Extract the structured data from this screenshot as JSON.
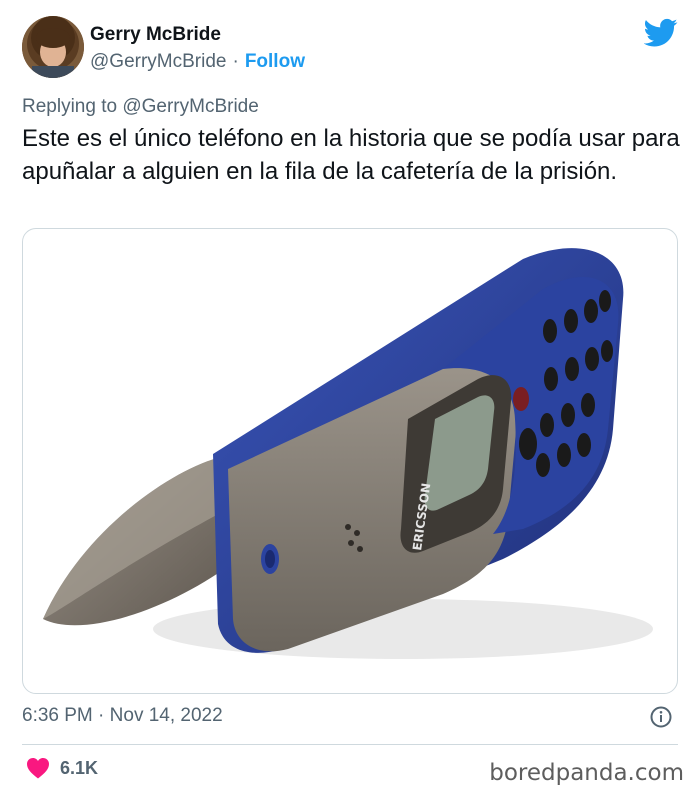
{
  "tweet": {
    "author_name": "Gerry McBride",
    "author_handle": "@GerryMcBride",
    "separator": "·",
    "follow_label": "Follow",
    "replying_prefix": "Replying to",
    "replying_handle": "@GerryMcBride",
    "text": "Este es el único teléfono en la historia que se podía usar para apuñalar a alguien en la fila de la cafetería de la prisión.",
    "time": "6:36 PM",
    "date": "Nov 14, 2022",
    "likes": "6.1K"
  },
  "media": {
    "phone_brand": "ERICSSON"
  },
  "watermark": "boredpanda.com",
  "colors": {
    "accent": "#1d9bf0",
    "heart": "#f91880",
    "secondary_text": "#536471"
  },
  "icons": {
    "platform": "twitter-bird-icon",
    "info": "info-icon",
    "like": "heart-icon"
  }
}
